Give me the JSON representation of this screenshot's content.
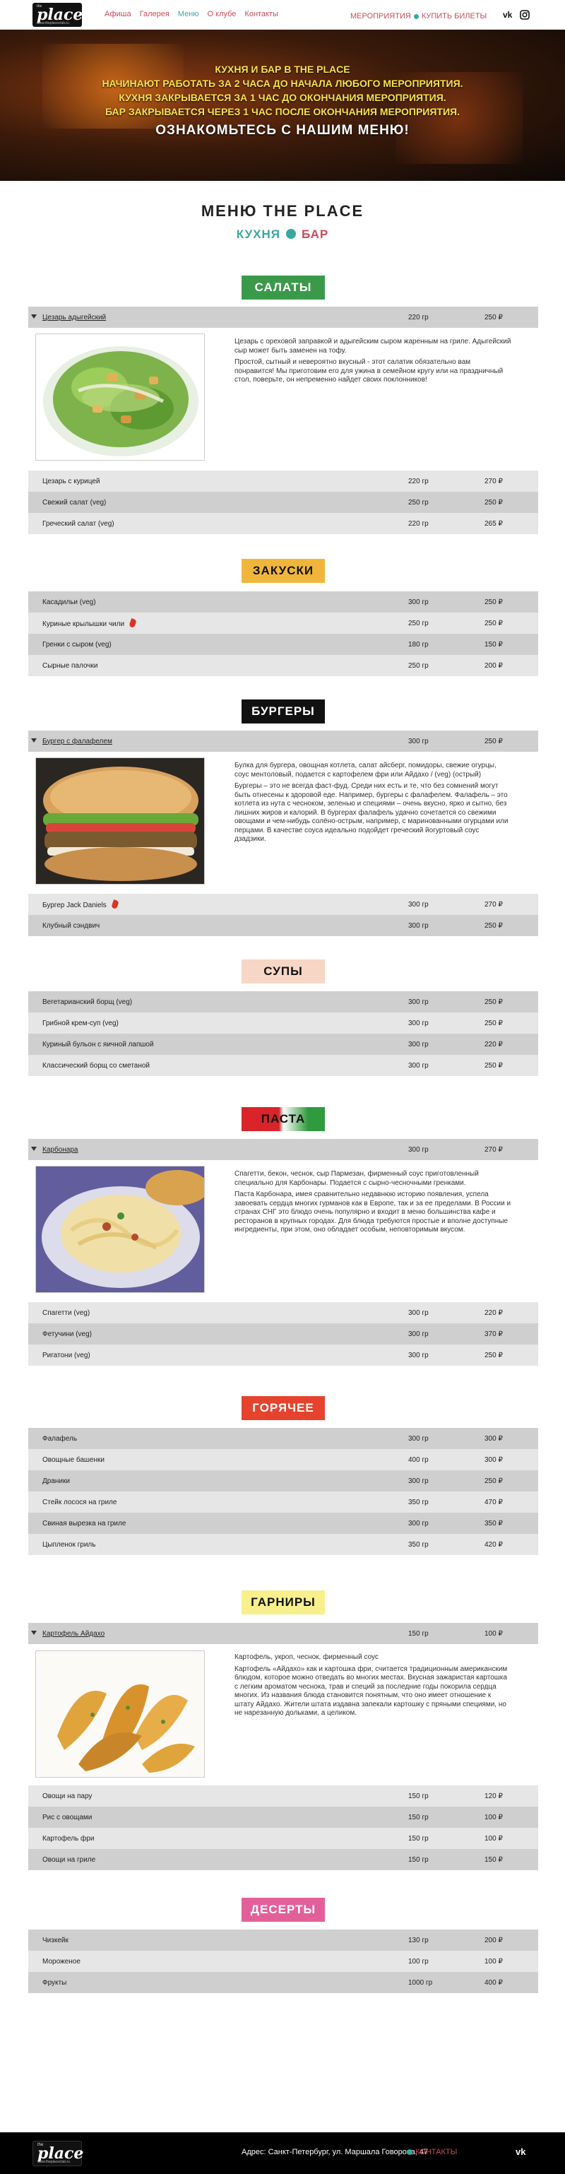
{
  "header": {
    "logo_small": "the",
    "logo_big": "place",
    "logo_url": "www.theplaceclub.ru",
    "nav": [
      "Афиша",
      "Галерея",
      "Меню",
      "О клубе",
      "Контакты"
    ],
    "events_link": "МЕРОПРИЯТИЯ",
    "tickets_link": "КУПИТЬ БИЛЕТЫ",
    "vk_icon": "vk-icon",
    "instagram_icon": "instagram-icon"
  },
  "hero": {
    "lines": [
      "КУХНЯ И БАР В THE PLACE",
      "НАЧИНАЮТ РАБОТАТЬ ЗА  2 ЧАСА ДО НАЧАЛА ЛЮБОГО МЕРОПРИЯТИЯ.",
      "КУХНЯ ЗАКРЫВАЕТСЯ ЗА 1 ЧАС ДО ОКОНЧАНИЯ МЕРОПРИЯТИЯ.",
      "БАР ЗАКРЫВАЕТСЯ ЧЕРЕЗ 1 ЧАС ПОСЛЕ ОКОНЧАНИЯ МЕРОПРИЯТИЯ."
    ],
    "cta": "ОЗНАКОМЬТЕСЬ С НАШИМ МЕНЮ!"
  },
  "menu": {
    "title": "МЕНЮ THE PLACE",
    "kitchen": "КУХНЯ",
    "bar": "БАР"
  },
  "categories": {
    "salads": {
      "title": "САЛАТЫ",
      "color": "#3b9a4a"
    },
    "snacks": {
      "title": "ЗАКУСКИ",
      "color": "#f0b63c"
    },
    "burgers": {
      "title": "БУРГЕРЫ",
      "color": "#111111"
    },
    "soups": {
      "title": "СУПЫ",
      "color": "#f6d6c4"
    },
    "pasta": {
      "title": "ПАСТА",
      "color": "#d8242a"
    },
    "hot": {
      "title": "ГОРЯЧЕЕ",
      "color": "#e5432e"
    },
    "garnish": {
      "title": "ГАРНИРЫ",
      "color": "#f7f08c"
    },
    "desserts": {
      "title": "ДЕСЕРТЫ",
      "color": "#e2609a"
    }
  },
  "salads": {
    "featured": {
      "name": "Цезарь адыгейский",
      "weight": "220 гр",
      "price": "250 ₽",
      "desc": [
        "Цезарь с ореховой заправкой и адыгейским сыром жаренным на гриле. Адыгейский сыр может быть заменен на тофу.",
        "Простой, сытный и невероятно вкусный - этот салатик обязательно вам понравится! Мы приготовим его для ужина в семейном кругу или на праздничный стол, поверьте, он непременно найдет своих поклонников!"
      ]
    },
    "items": [
      {
        "name": "Цезарь с курицей",
        "weight": "220 гр",
        "price": "270 ₽"
      },
      {
        "name": "Свежий салат (veg)",
        "weight": "250 гр",
        "price": "250 ₽"
      },
      {
        "name": "Греческий салат (veg)",
        "weight": "220 гр",
        "price": "265 ₽"
      }
    ]
  },
  "snacks": {
    "items": [
      {
        "name": "Касадильи (veg)",
        "weight": "300 гр",
        "price": "250 ₽"
      },
      {
        "name": "Куриные крылышки чили",
        "weight": "250 гр",
        "price": "250 ₽"
      },
      {
        "name": "Гренки с сыром (veg)",
        "weight": "180 гр",
        "price": "150 ₽"
      },
      {
        "name": "Сырные палочки",
        "weight": "250 гр",
        "price": "200 ₽"
      }
    ]
  },
  "burgers": {
    "featured": {
      "name": "Бургер с фалафелем",
      "weight": "300 гр",
      "price": "250 ₽",
      "desc": [
        "Булка для бургера, овощная котлета, салат айсберг, помидоры, свежие огурцы, соус ментоловый, подается с картофелем фри или Айдахо / (veg) (острый)",
        "Бургеры – это не всегда фаст-фуд. Среди них есть и те, что без сомнений могут быть отнесены к здоровой еде. Например, бургеры с фалафелем. Фалафель – это котлета из нута с чесноком, зеленью и специями – очень вкусно, ярко и сытно, без лишних жиров и калорий. В бургерах фалафель удачно сочетается со свежими овощами и чем-нибудь солёно-острым, например, с маринованными огурцами или перцами. В качестве соуса идеально подойдет греческий йогуртовый соус дзадзики."
      ]
    },
    "items": [
      {
        "name": "Бургер Jack Daniels",
        "weight": "300 гр",
        "price": "270 ₽"
      },
      {
        "name": "Клубный сэндвич",
        "weight": "300 гр",
        "price": "250 ₽"
      }
    ]
  },
  "soups": {
    "items": [
      {
        "name": "Вегетарианский борщ (veg)",
        "weight": "300 гр",
        "price": "250 ₽"
      },
      {
        "name": "Грибной крем-суп (veg)",
        "weight": "300 гр",
        "price": "250 ₽"
      },
      {
        "name": "Куриный бульон с яичной лапшой",
        "weight": "300 гр",
        "price": "220 ₽"
      },
      {
        "name": "Классический борщ со сметаной",
        "weight": "300 гр",
        "price": "250 ₽"
      }
    ]
  },
  "pasta": {
    "featured": {
      "name": "Карбонара",
      "weight": "300 гр",
      "price": "270 ₽",
      "desc": [
        "Спагетти, бекон, чеснок, сыр Пармезан, фирменный соус приготовленный специально для Карбонары. Подается с сырно-чесночными гренками.",
        "Паста Карбонара, имея сравнительно недавнюю историю появления, успела завоевать сердца многих гурманов как в Европе, так и за ее пределами. В России и странах СНГ это блюдо очень популярно и входит в меню большинства кафе и ресторанов в крупных городах. Для блюда требуются простые и вполне доступные ингредиенты, при этом, оно обладает особым, неповторимым вкусом."
      ]
    },
    "items": [
      {
        "name": "Спагетти (veg)",
        "weight": "300 гр",
        "price": "220 ₽"
      },
      {
        "name": "Фетучини (veg)",
        "weight": "300 гр",
        "price": "370 ₽"
      },
      {
        "name": "Ригатони (veg)",
        "weight": "300 гр",
        "price": "250 ₽"
      }
    ]
  },
  "hot": {
    "items": [
      {
        "name": "Фалафель",
        "weight": "300 гр",
        "price": "300 ₽"
      },
      {
        "name": "Овощные башенки",
        "weight": "400 гр",
        "price": "300 ₽"
      },
      {
        "name": "Драники",
        "weight": "300 гр",
        "price": "250 ₽"
      },
      {
        "name": "Стейк лосося на гриле",
        "weight": "350 гр",
        "price": "470 ₽"
      },
      {
        "name": "Свиная вырезка на гриле",
        "weight": "300 гр",
        "price": "350 ₽"
      },
      {
        "name": "Цыпленок гриль",
        "weight": "350 гр",
        "price": "420 ₽"
      }
    ]
  },
  "garnish": {
    "featured": {
      "name": "Картофель Айдахо",
      "weight": "150 гр",
      "price": "100 ₽",
      "desc": [
        "Картофель, укроп, чеснок, фирменный соус",
        "Картофель «Айдахо» как и картошка фри, считается традиционным американским блюдом, которое можно отведать во многих местах. Вкусная зажаристая картошка с легким ароматом чеснока, трав и специй за последние годы покорила сердца многих. Из названия блюда становится понятным, что оно имеет отношение к штату Айдахо. Жители штата издавна запекали картошку с пряными специями, но не нарезанную дольками, а целиком."
      ]
    },
    "items": [
      {
        "name": "Овощи на пару",
        "weight": "150 гр",
        "price": "120 ₽"
      },
      {
        "name": "Рис с овощами",
        "weight": "150 гр",
        "price": "100 ₽"
      },
      {
        "name": "Картофель фри",
        "weight": "150 гр",
        "price": "100 ₽"
      },
      {
        "name": "Овощи на гриле",
        "weight": "150 гр",
        "price": "150 ₽"
      }
    ]
  },
  "desserts": {
    "items": [
      {
        "name": "Чизкейк",
        "weight": "130 гр",
        "price": "200 ₽"
      },
      {
        "name": "Мороженое",
        "weight": "100 гр",
        "price": "100 ₽"
      },
      {
        "name": "Фрукты",
        "weight": "1000 гр",
        "price": "400 ₽"
      }
    ]
  },
  "footer": {
    "address": "Адрес: Санкт-Петербург, ул. Маршала Говорова, 47",
    "contacts": "КОНТАКТЫ",
    "logo_small": "the",
    "logo_big": "place",
    "logo_url": "www.theplaceclub.ru",
    "vk": "vk-icon"
  }
}
